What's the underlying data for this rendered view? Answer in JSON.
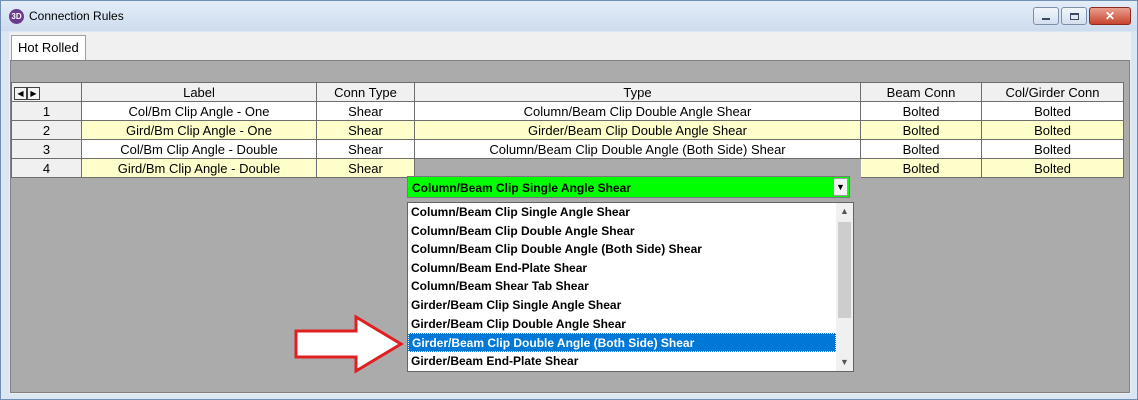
{
  "window": {
    "icon_text": "3D",
    "title": "Connection Rules"
  },
  "tabs": [
    {
      "label": "Hot Rolled"
    }
  ],
  "grid": {
    "columns": [
      "Label",
      "Conn Type",
      "Type",
      "Beam Conn",
      "Col/Girder Conn"
    ],
    "rows": [
      {
        "num": "1",
        "label": "Col/Bm Clip Angle - One",
        "conn_type": "Shear",
        "type": "Column/Beam Clip Double Angle Shear",
        "beam_conn": "Bolted",
        "col_conn": "Bolted"
      },
      {
        "num": "2",
        "label": "Gird/Bm Clip Angle - One",
        "conn_type": "Shear",
        "type": "Girder/Beam Clip Double Angle Shear",
        "beam_conn": "Bolted",
        "col_conn": "Bolted"
      },
      {
        "num": "3",
        "label": "Col/Bm Clip Angle - Double",
        "conn_type": "Shear",
        "type": "Column/Beam Clip Double Angle (Both Side) Shear",
        "beam_conn": "Bolted",
        "col_conn": "Bolted"
      },
      {
        "num": "4",
        "label": "Gird/Bm Clip Angle - Double",
        "conn_type": "Shear",
        "type": "",
        "beam_conn": "Bolted",
        "col_conn": "Bolted"
      }
    ]
  },
  "combo": {
    "value": "Column/Beam Clip Single Angle Shear",
    "background": "#00ff00"
  },
  "dropdown": {
    "options": [
      "Column/Beam Clip Single Angle Shear",
      "Column/Beam Clip Double Angle Shear",
      "Column/Beam Clip Double Angle (Both Side) Shear",
      "Column/Beam End-Plate Shear",
      "Column/Beam Shear Tab Shear",
      "Girder/Beam Clip Single Angle Shear",
      "Girder/Beam Clip Double Angle Shear",
      "Girder/Beam Clip Double Angle (Both Side) Shear",
      "Girder/Beam End-Plate Shear"
    ],
    "highlighted": "Girder/Beam Clip Double Angle (Both Side) Shear",
    "highlight_color": "#0078d7"
  },
  "annotation": {
    "arrow_color": "#e02020"
  }
}
